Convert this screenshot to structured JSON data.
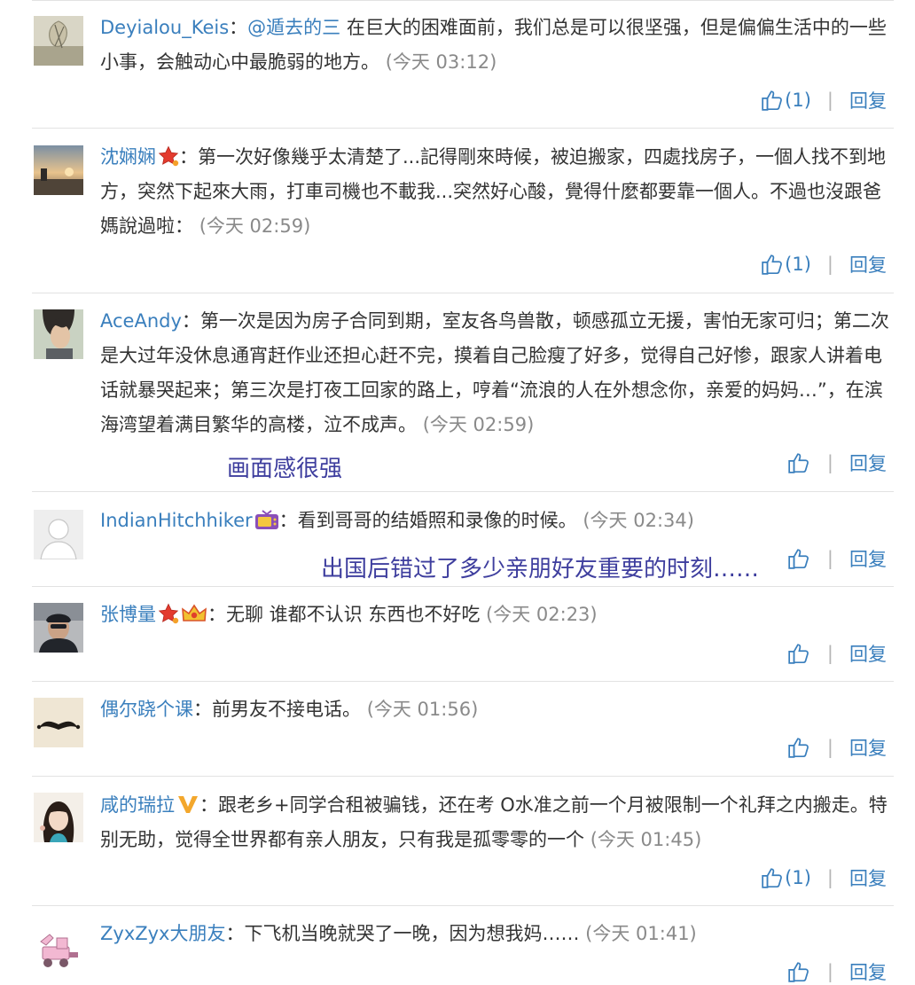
{
  "labels": {
    "reply": "回复"
  },
  "colors": {
    "link": "#3a7fbd",
    "text": "#333333",
    "time": "#8a8a8a",
    "separator": "#b5b5b5",
    "overlay": "#3e3e9e"
  },
  "comments": [
    {
      "user": "Deyialou_Keis",
      "mention": "@遁去的三",
      "text": " 在巨大的困难面前，我们总是可以很坚强，但是偏偏生活中的一些小事，会触动心中最脆弱的地方。 ",
      "time": "(今天 03:12)",
      "likes": "(1)"
    },
    {
      "user": "沈娴娴",
      "text": "第一次好像幾乎太清楚了...記得剛來時候，被迫搬家，四處找房子，一個人找不到地方，突然下起來大雨，打車司機也不載我...突然好心酸，覺得什麼都要靠一個人。不過也沒跟爸媽說過啦： ",
      "time": "(今天 02:59)",
      "likes": "(1)",
      "badges": [
        "red-star-icon"
      ]
    },
    {
      "user": "AceAndy",
      "text": "第一次是因为房子合同到期，室友各鸟兽散，顿感孤立无援，害怕无家可归；第二次是大过年没休息通宵赶作业还担心赶不完，摸着自己脸瘦了好多，觉得自己好惨，跟家人讲着电话就暴哭起来；第三次是打夜工回家的路上，哼着“流浪的人在外想念你，亲爱的妈妈…”，在滨海湾望着满目繁华的高楼，泣不成声。 ",
      "time": "(今天 02:59)",
      "likes": ""
    },
    {
      "user": "IndianHitchhiker",
      "text": "看到哥哥的结婚照和录像的时候。 ",
      "time": "(今天 02:34)",
      "likes": "",
      "badges": [
        "tv-icon"
      ]
    },
    {
      "user": "张博量",
      "text": "无聊 谁都不认识 东西也不好吃 ",
      "time": "(今天 02:23)",
      "likes": "",
      "badges": [
        "red-star-icon",
        "crown-icon"
      ]
    },
    {
      "user": "偶尔跷个课",
      "text": "前男友不接电话。 ",
      "time": "(今天 01:56)",
      "likes": ""
    },
    {
      "user": "咸的瑞拉",
      "text": "跟老乡+同学合租被骗钱，还在考 O水准之前一个月被限制一个礼拜之内搬走。特别无助，觉得全世界都有亲人朋友，只有我是孤零零的一个 ",
      "time": "(今天 01:45)",
      "likes": "(1)",
      "badges": [
        "verified-v-icon"
      ]
    },
    {
      "user": "ZyxZyx大朋友",
      "text": "下飞机当晚就哭了一晚，因为想我妈…… ",
      "time": "(今天 01:41)",
      "likes": ""
    }
  ],
  "overlays": {
    "caption1": "画面感很强",
    "caption2": "出国后错过了多少亲朋好友重要的时刻……"
  }
}
